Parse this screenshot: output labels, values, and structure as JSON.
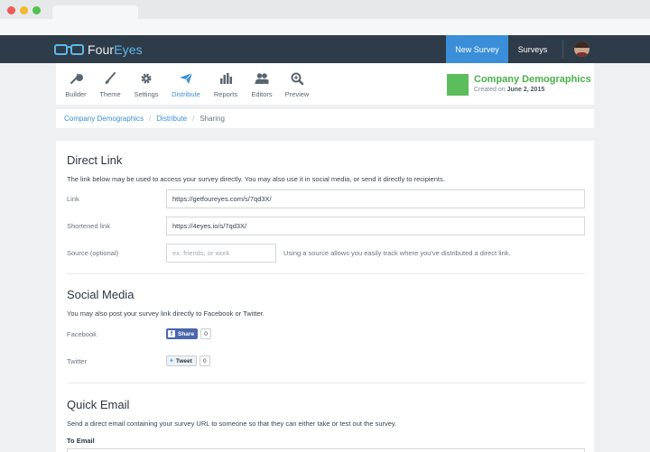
{
  "navbar": {
    "logo_part1": "Four",
    "logo_part2": "Eyes",
    "new_survey_label": "New Survey",
    "surveys_label": "Surveys"
  },
  "toolbar": {
    "tools": [
      {
        "label": "Builder",
        "icon": "wrench-icon"
      },
      {
        "label": "Theme",
        "icon": "brush-icon"
      },
      {
        "label": "Settings",
        "icon": "gear-icon"
      },
      {
        "label": "Distribute",
        "icon": "paper-plane-icon",
        "active": true
      },
      {
        "label": "Reports",
        "icon": "bar-chart-icon"
      },
      {
        "label": "Editors",
        "icon": "users-icon"
      },
      {
        "label": "Preview",
        "icon": "magnifier-icon"
      }
    ],
    "survey_title": "Company Demographics",
    "created_prefix": "Created on",
    "created_date": "June 2, 2015"
  },
  "breadcrumb": {
    "items": [
      "Company Demographics",
      "Distribute",
      "Sharing"
    ]
  },
  "direct_link": {
    "title": "Direct Link",
    "description": "The link below may be used to access your survey directly. You may also use it in social media, or send it directly to recipients.",
    "link_label": "Link",
    "link_value": "https://getfoureyes.com/s/7qd3X/",
    "short_label": "Shortened link",
    "short_value": "https://4eyes.io/s/7qd3X/",
    "source_label": "Source (optional)",
    "source_placeholder": "ex. friends, or work",
    "source_hint": "Using a source allows you easily track where you've distributed a direct link."
  },
  "social": {
    "title": "Social Media",
    "description": "You may also post your survey link directly to Facebook or Twitter.",
    "facebook_label": "Facebook",
    "facebook_button": "Share",
    "facebook_count": "0",
    "twitter_label": "Twitter",
    "twitter_button": "Tweet",
    "twitter_count": "0"
  },
  "quick_email": {
    "title": "Quick Email",
    "description": "Send a direct email containing your survey URL to someone so that they can either take or test out the survey.",
    "to_label": "To Email"
  },
  "colors": {
    "navbar_bg": "#2e3b48",
    "accent_blue": "#3a8fd8",
    "survey_green": "#5cbd5c"
  }
}
